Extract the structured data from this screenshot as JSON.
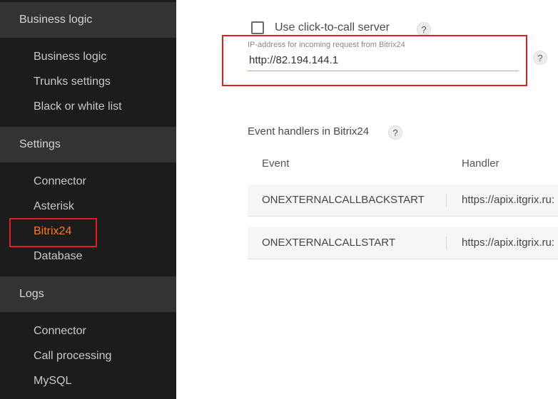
{
  "sidebar": {
    "sections": [
      {
        "title": "Business logic",
        "items": [
          "Business logic",
          "Trunks settings",
          "Black or white list"
        ]
      },
      {
        "title": "Settings",
        "items": [
          "Connector",
          "Asterisk",
          "Bitrix24",
          "Database"
        ]
      },
      {
        "title": "Logs",
        "items": [
          "Connector",
          "Call processing",
          "MySQL"
        ]
      }
    ],
    "active_item": "Bitrix24"
  },
  "main": {
    "click_to_call": {
      "label": "Use click-to-call server",
      "checked": false
    },
    "ip_field": {
      "label": "IP-address for incoming request from Bitrix24",
      "value": "http://82.194.144.1"
    },
    "help_glyph": "?",
    "event_handlers": {
      "title": "Event handlers in Bitrix24",
      "columns": [
        "Event",
        "Handler"
      ],
      "rows": [
        {
          "event": "ONEXTERNALCALLBACKSTART",
          "handler": "https://apix.itgrix.ru:"
        },
        {
          "event": "ONEXTERNALCALLSTART",
          "handler": "https://apix.itgrix.ru:"
        }
      ]
    }
  },
  "colors": {
    "accent": "#ff7a22",
    "highlight": "#e0201e",
    "sidebar_bg": "#1c1c1c",
    "section_bg": "#333333"
  }
}
